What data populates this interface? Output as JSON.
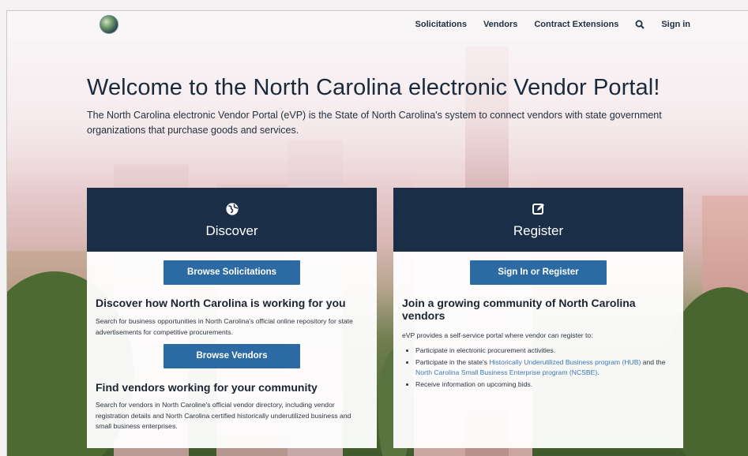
{
  "nav": {
    "links": [
      "Solicitations",
      "Vendors",
      "Contract Extensions"
    ],
    "sign_in": "Sign in"
  },
  "hero": {
    "title": "Welcome to the North Carolina electronic Vendor Portal!",
    "description": "The North Carolina electronic Vendor Portal (eVP) is the State of North Carolina's system to connect vendors with state government organizations that purchase goods and services."
  },
  "discover": {
    "title": "Discover",
    "icon": "globe-icon",
    "browse_solicitations": "Browse Solicitations",
    "heading1": "Discover how North Carolina is working for you",
    "text1": "Search for business opportunities in North Carolina's official online repository for state advertisements for competitive procurements.",
    "browse_vendors": "Browse Vendors",
    "heading2": "Find vendors working for your community",
    "text2": "Search for vendors in North Caroline's official vendor directory, including vendor registration details and North Carolina certified historically underutilized business and small business enterprises."
  },
  "register": {
    "title": "Register",
    "icon": "edit-icon",
    "button": "Sign In or Register",
    "heading": "Join a growing community of North Carolina vendors",
    "intro": "eVP provides a self-service portal where vendor can register to:",
    "bullet1": "Participate in electronic procurement activities.",
    "bullet2_prefix": "Participate in the state's",
    "bullet2_link1": "Historically Underutilized Business program (HUB)",
    "bullet2_mid": "and the",
    "bullet2_link2": "North Carolina Small Business Enterprise program (NCSBE)",
    "bullet2_suffix": ".",
    "bullet3": "Receive information on upcoming bids."
  },
  "colors": {
    "card_header": "#1a2f47",
    "button": "#2c6aa3",
    "link": "#3a78b5"
  }
}
